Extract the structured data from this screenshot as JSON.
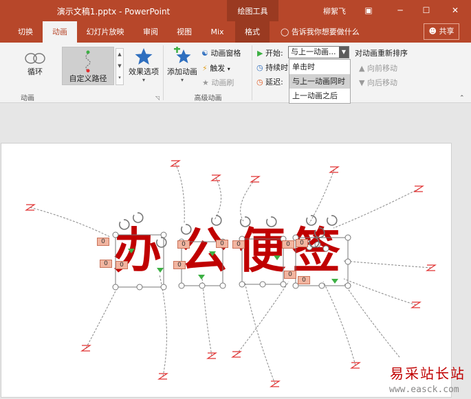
{
  "window": {
    "title": "演示文稿1.pptx - PowerPoint",
    "context_tab_group": "绘图工具",
    "user": "柳絮飞",
    "controls": [
      "▣",
      "─",
      "☐",
      "✕"
    ]
  },
  "tabs": [
    {
      "label": "切换"
    },
    {
      "label": "动画",
      "active": true
    },
    {
      "label": "幻灯片放映"
    },
    {
      "label": "审阅"
    },
    {
      "label": "视图"
    },
    {
      "label": "Mix"
    },
    {
      "label": "格式",
      "context": true
    }
  ],
  "tellme": "告诉我你想要做什么",
  "share": "共享",
  "ribbon": {
    "effects": [
      {
        "label": "循环",
        "icon": "loop-icon"
      },
      {
        "label": "自定义路径",
        "icon": "custom-path-icon",
        "selected": true
      }
    ],
    "effect_options": "效果选项",
    "group_animation": "动画",
    "add_animation": "添加动画",
    "animation_pane": "动画窗格",
    "trigger": "触发",
    "animation_painter": "动画刷",
    "group_advanced": "高级动画",
    "start_label": "开始:",
    "start_value": "与上一动画...",
    "duration_label": "持续时",
    "delay_label": "延迟:",
    "reorder": "对动画重新排序",
    "move_earlier": "向前移动",
    "move_later": "向后移动"
  },
  "dropdown": {
    "options": [
      {
        "label": "单击时"
      },
      {
        "label": "与上一动画同时",
        "selected": true
      },
      {
        "label": "上一动画之后"
      }
    ]
  },
  "slide": {
    "text": [
      "办",
      "公",
      "便",
      "签"
    ],
    "tag_value": "0",
    "text_color": "#c00000",
    "path_color": "#888888",
    "end_marker_color": "#e03030",
    "start_marker_color": "#3cb043"
  },
  "watermark": {
    "cn": "易采站长站",
    "url": "www.easck.com"
  },
  "colors": {
    "accent": "#b7472a",
    "accent_dark": "#9a3a21",
    "ribbon_bg": "#f3f3f3"
  }
}
